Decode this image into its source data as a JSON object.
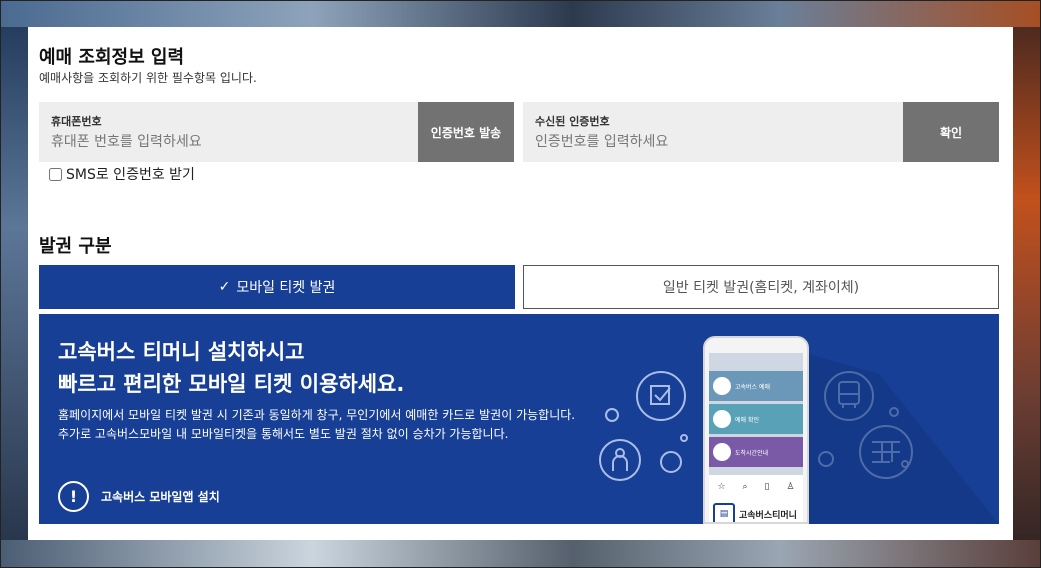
{
  "form": {
    "title": "예매 조회정보 입력",
    "subtitle": "예매사항을 조회하기 위한 필수항목 입니다.",
    "phone_label": "휴대폰번호",
    "phone_placeholder": "휴대폰 번호를 입력하세요",
    "send_code_button": "인증번호 발송",
    "code_label": "수신된 인증번호",
    "code_placeholder": "인증번호를 입력하세요",
    "confirm_button": "확인",
    "sms_checkbox_label": "SMS로 인증번호 받기"
  },
  "issue": {
    "title": "발권 구분",
    "tab_mobile": "모바일 티켓 발권",
    "tab_mobile_check": "✓",
    "tab_general": "일반 티켓 발권(홈티켓, 계좌이체)"
  },
  "banner": {
    "headline_1": "고속버스 티머니 설치하시고",
    "headline_2": "빠르고 편리한 모바일 티켓 이용하세요.",
    "body": "홈페이지에서 모바일 티켓 발권 시 기존과 동일하게 창구, 무인기에서 예매한 카드로 발권이 가능합니다. 추가로 고속버스모바일 내 모바일티켓을 통해서도 별도 발권 절차 없이 승차가 가능합니다.",
    "install_label": "고속버스 모바일앱 설치",
    "install_icon": "!",
    "phone_rows": [
      "고속버스 예매",
      "예매 확인",
      "도착시간안내"
    ],
    "phone_app_name": "고속버스티머니"
  },
  "colors": {
    "accent": "#173f96",
    "gray_button": "#727272"
  }
}
